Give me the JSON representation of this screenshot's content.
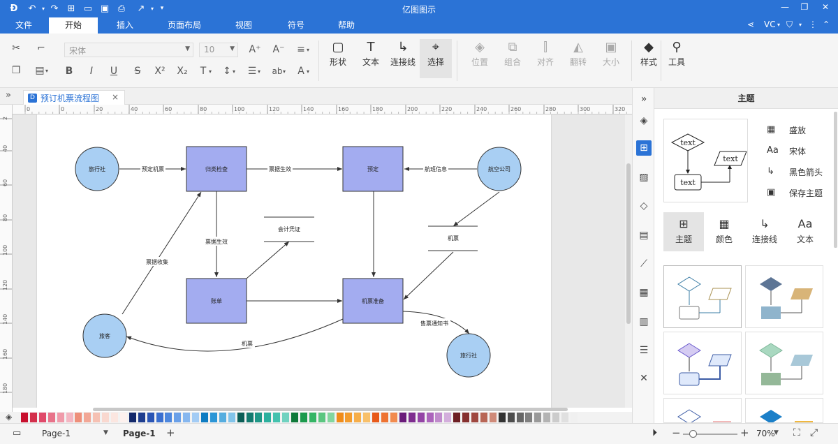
{
  "app": {
    "title": "亿图图示"
  },
  "menu": {
    "tabs": [
      "文件",
      "开始",
      "插入",
      "页面布局",
      "视图",
      "符号",
      "帮助"
    ],
    "active": "开始",
    "user": "VC"
  },
  "ribbon": {
    "font_name": "宋体",
    "font_size": "10",
    "big_buttons": [
      {
        "label": "形状",
        "icon": "rectangle-icon"
      },
      {
        "label": "文本",
        "icon": "text-icon"
      },
      {
        "label": "连接线",
        "icon": "connector-icon"
      },
      {
        "label": "选择",
        "icon": "cursor-icon"
      }
    ],
    "disabled_buttons": [
      "位置",
      "组合",
      "对齐",
      "翻转",
      "大小"
    ],
    "style_label": "样式",
    "tools_label": "工具"
  },
  "document": {
    "tab_title": "预订机票流程图"
  },
  "ruler": {
    "h_ticks": [
      "0",
      "0",
      "20",
      "40",
      "60",
      "80",
      "100",
      "120",
      "140",
      "160",
      "180",
      "200",
      "220",
      "240",
      "260",
      "280",
      "300",
      "320"
    ],
    "v_ticks": [
      "2",
      "40",
      "60",
      "80",
      "100",
      "120",
      "140",
      "160",
      "180"
    ]
  },
  "diagram": {
    "nodes": {
      "agency_left": "旅行社",
      "classify": "归类检查",
      "reserve": "预定",
      "airline": "航空公司",
      "accounting": "会计凭证",
      "ticket_store": "机票",
      "bill": "账单",
      "ticket_prep": "机票准备",
      "traveler": "旅客",
      "agency_bottom": "旅行社"
    },
    "edges": {
      "reserve_ticket": "预定机票",
      "ticket_valid_1": "票据生效",
      "flight_info": "航班信息",
      "ticket_valid_2": "票据生效",
      "collect": "票据收集",
      "sale_notice": "售票通知书",
      "ticket": "机票"
    }
  },
  "panel": {
    "title": "主题",
    "preview_texts": [
      "text",
      "text",
      "text"
    ],
    "options": [
      {
        "label": "盛放",
        "icon": "palette-icon"
      },
      {
        "label": "宋体",
        "icon": "font-icon"
      },
      {
        "label": "黑色箭头",
        "icon": "arrow-icon"
      },
      {
        "label": "保存主题",
        "icon": "save-icon"
      }
    ],
    "tabs": [
      {
        "label": "主题",
        "icon": "theme-icon"
      },
      {
        "label": "颜色",
        "icon": "color-icon"
      },
      {
        "label": "连接线",
        "icon": "connector-icon"
      },
      {
        "label": "文本",
        "icon": "text-icon"
      }
    ]
  },
  "status": {
    "page_selector": "Page-1",
    "page_tab": "Page-1",
    "zoom": "70%"
  }
}
